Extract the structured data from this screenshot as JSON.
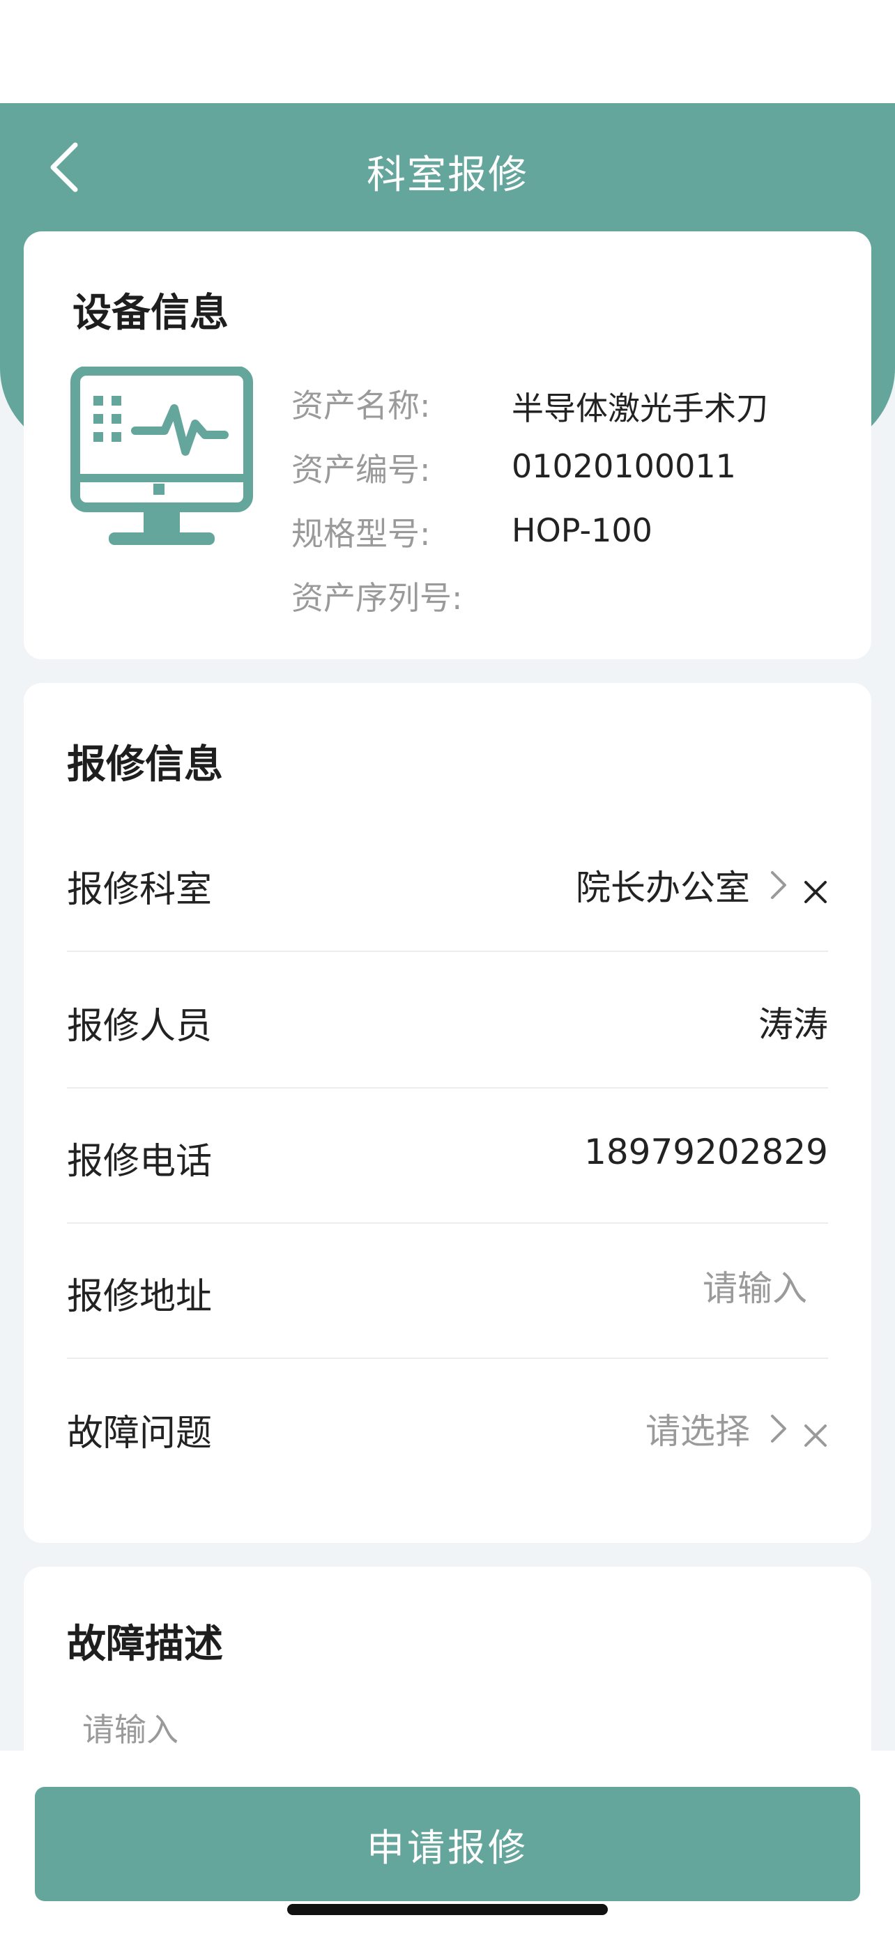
{
  "header": {
    "title": "科室报修",
    "back_icon": "chevron-left-icon"
  },
  "device_card": {
    "title": "设备信息",
    "icon": "monitor-heartbeat-icon",
    "fields": [
      {
        "label": "资产名称:",
        "value": "半导体激光手术刀"
      },
      {
        "label": "资产编号:",
        "value": "01020100011"
      },
      {
        "label": "规格型号:",
        "value": "HOP-100"
      },
      {
        "label": "资产序列号:",
        "value": ""
      }
    ]
  },
  "repair_card": {
    "title": "报修信息",
    "department": {
      "label": "报修科室",
      "value": "院长办公室"
    },
    "person": {
      "label": "报修人员",
      "value": "涛涛"
    },
    "phone": {
      "label": "报修电话",
      "value": "18979202829"
    },
    "address": {
      "label": "报修地址",
      "placeholder": "请输入"
    },
    "fault": {
      "label": "故障问题",
      "placeholder": "请选择"
    }
  },
  "description_card": {
    "title": "故障描述",
    "placeholder": "请输入"
  },
  "submit": {
    "label": "申请报修"
  },
  "colors": {
    "primary": "#65a69c",
    "background": "#f1f4f7",
    "card": "#ffffff",
    "muted_text": "#9a9a9a"
  }
}
